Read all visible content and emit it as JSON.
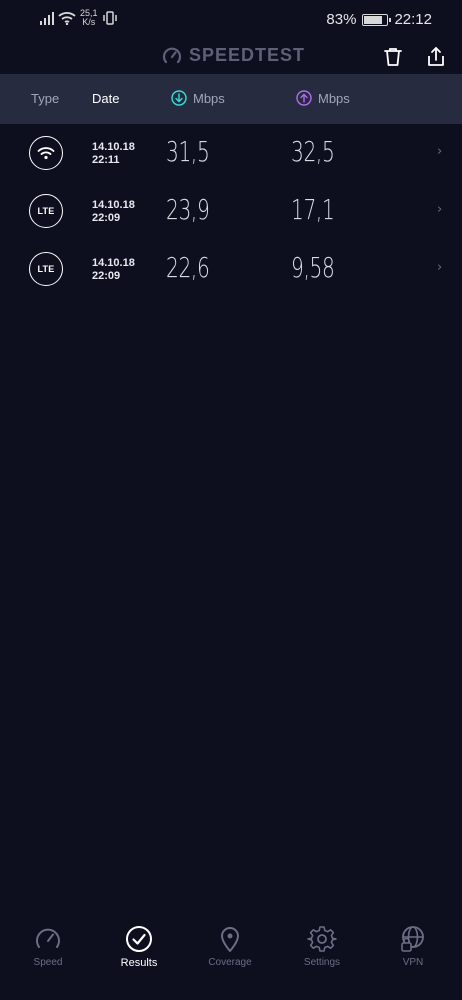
{
  "status_bar": {
    "net_speed_value": "25,1",
    "net_speed_unit": "K/s",
    "battery": "83%",
    "battery_level": 0.83,
    "time": "22:12"
  },
  "header": {
    "title": "SPEEDTEST",
    "icons": [
      "speedometer-icon",
      "trash-icon",
      "share-icon"
    ]
  },
  "columns": {
    "type": "Type",
    "date": "Date",
    "download": "Mbps",
    "upload": "Mbps"
  },
  "results": [
    {
      "type": "wifi",
      "type_icon": "wifi-icon",
      "type_label": "",
      "date": "14.10.18",
      "time": "22:11",
      "download": "31,5",
      "upload": "32,5"
    },
    {
      "type": "lte",
      "type_icon": "lte-icon",
      "type_label": "LTE",
      "date": "14.10.18",
      "time": "22:09",
      "download": "23,9",
      "upload": "17,1"
    },
    {
      "type": "lte",
      "type_icon": "lte-icon",
      "type_label": "LTE",
      "date": "14.10.18",
      "time": "22:09",
      "download": "22,6",
      "upload": "9,58"
    }
  ],
  "bottom_nav": [
    {
      "label": "Speed",
      "icon": "speed-icon",
      "active": false
    },
    {
      "label": "Results",
      "icon": "results-check-icon",
      "active": true
    },
    {
      "label": "Coverage",
      "icon": "map-pin-icon",
      "active": false
    },
    {
      "label": "Settings",
      "icon": "gear-icon",
      "active": false
    },
    {
      "label": "VPN",
      "icon": "vpn-globe-icon",
      "active": false
    }
  ],
  "colors": {
    "background": "#0d0f1f",
    "header_bar": "#272b3f",
    "download_accent": "#35e0d6",
    "upload_accent": "#b26cf0",
    "muted": "#6b6e85"
  }
}
